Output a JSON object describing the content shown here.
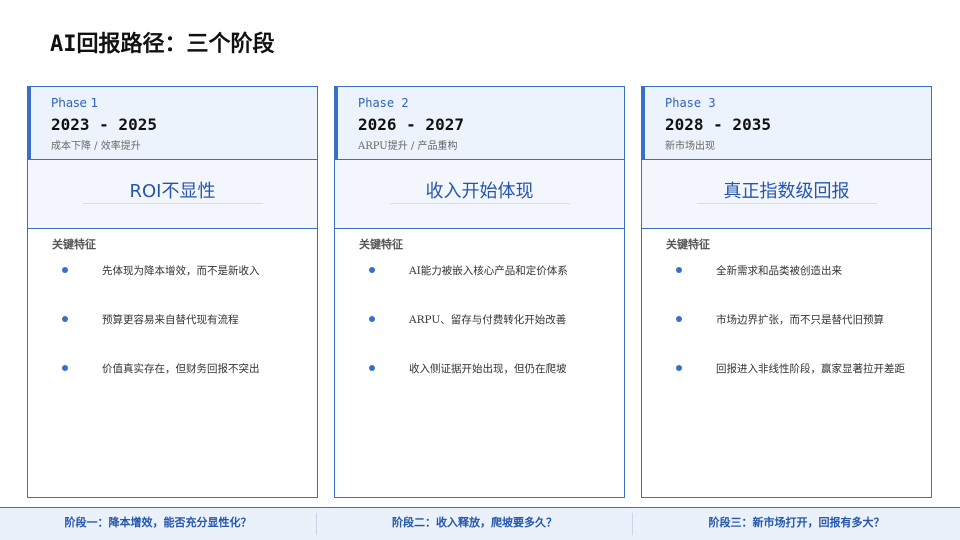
{
  "title": "AI回报路径：三个阶段",
  "section_label": "关键特征",
  "phases": [
    {
      "phase": "Phase 1",
      "years": "2023 - 2025",
      "subtitle": "成本下降 / 效率提升",
      "headline": "ROI不显性",
      "bullets": [
        "先体现为降本增效，而不是新收入",
        "预算更容易来自替代现有流程",
        "价值真实存在，但财务回报不突出"
      ]
    },
    {
      "phase": "Phase 2",
      "years": "2026 - 2027",
      "subtitle": "ARPU提升 / 产品重构",
      "headline": "收入开始体现",
      "bullets": [
        "AI能力被嵌入核心产品和定价体系",
        "ARPU、留存与付费转化开始改善",
        "收入侧证据开始出现，但仍在爬坡"
      ]
    },
    {
      "phase": "Phase 3",
      "years": "2028 - 2035",
      "subtitle": "新市场出现",
      "headline": "真正指数级回报",
      "bullets": [
        "全新需求和品类被创造出来",
        "市场边界扩张，而不只是替代旧预算",
        "回报进入非线性阶段，赢家显著拉开差距"
      ]
    }
  ],
  "footer": [
    "阶段一：降本增效，能否充分显性化？",
    "阶段二：收入释放，爬坡要多久？",
    "阶段三：新市场打开，回报有多大？"
  ],
  "colors": {
    "accent": "#3a6fc8",
    "headline": "#2456ad",
    "panel": "#edf3fc"
  }
}
